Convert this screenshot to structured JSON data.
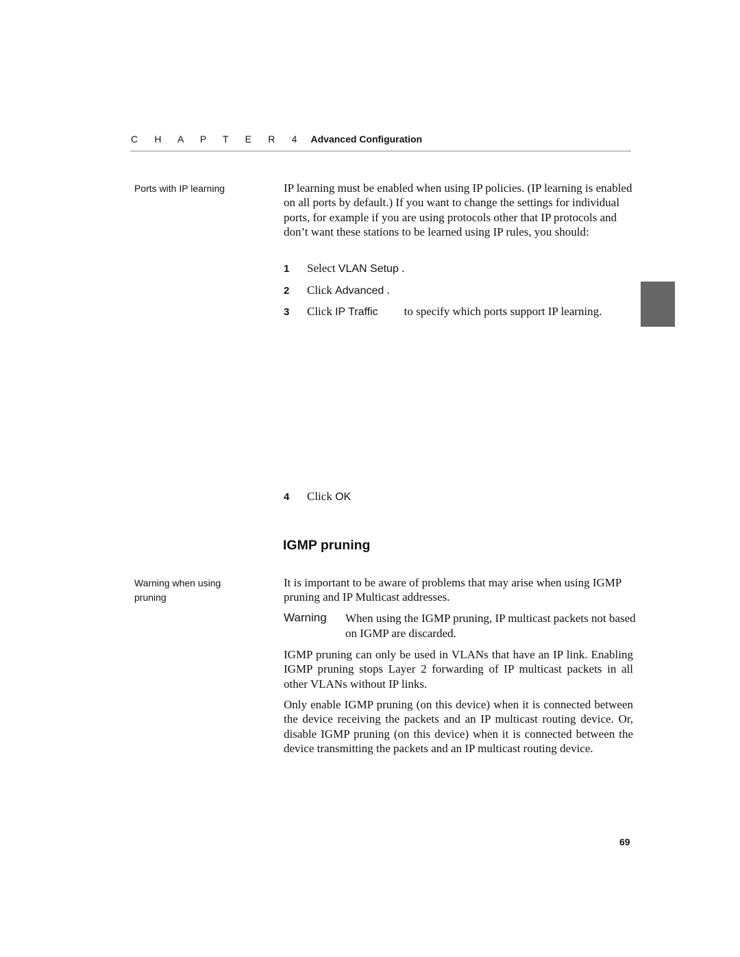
{
  "header": {
    "chapter_label": "C H A P T E R 4",
    "chapter_title": "Advanced Configuration"
  },
  "sections": {
    "ports": {
      "side_label": "Ports with IP learning",
      "intro": "IP learning must be enabled when using IP policies. (IP learning is enabled on all ports by default.) If you want to change the settings for individual ports, for example if you are using protocols other that IP protocols and don’t want these stations to be learned using IP rules, you should:",
      "steps": [
        {
          "num": "1",
          "prefix": "Select ",
          "ui": "VLAN Setup",
          "suffix": " ."
        },
        {
          "num": "2",
          "prefix": "Click ",
          "ui": "Advanced",
          "suffix": " ."
        },
        {
          "num": "3",
          "prefix": "Click ",
          "ui": "IP Traffic",
          "suffix": "to specify which ports support IP learning."
        },
        {
          "num": "4",
          "prefix": "Click ",
          "ui": "OK",
          "suffix": ""
        }
      ]
    },
    "igmp": {
      "heading": "IGMP pruning",
      "side_label": "Warning when using pruning",
      "intro": "It is important to be aware of problems that may arise when using IGMP pruning and IP Multicast addresses.",
      "warning_label": "Warning",
      "warning_text": "When using the IGMP pruning, IP multicast packets not based on IGMP are discarded.",
      "para1": "IGMP pruning can only be used in VLANs that have an IP link. Enabling IGMP pruning stops Layer 2 forwarding of IP multicast packets in all other VLANs without IP links.",
      "para2": "Only enable IGMP pruning (on this device) when it is connected between the device receiving the packets and an IP multicast routing device. Or, disable IGMP pruning (on this device) when it is connected between the device transmitting the packets and an IP multicast routing device."
    }
  },
  "footer": {
    "page_number": "69"
  },
  "colors": {
    "thumb_tab": "#666666",
    "rule": "#8a8a8a"
  }
}
